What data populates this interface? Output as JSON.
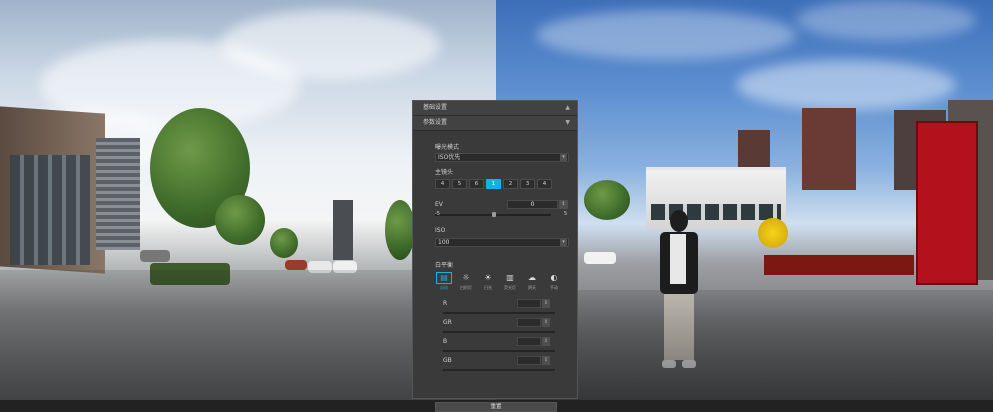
{
  "panel": {
    "section_basic": "基础设置",
    "section_params": "参数设置",
    "exposure_mode_label": "曝光模式",
    "exposure_mode_value": "ISO优先",
    "main_lens_label": "主镜头",
    "lens_options": [
      "4",
      "5",
      "6",
      "1",
      "2",
      "3",
      "4"
    ],
    "lens_selected": "1",
    "ev_label": "EV",
    "ev_value": "0",
    "ev_min": "-5",
    "ev_max": "5",
    "iso_label": "ISO",
    "iso_value": "100",
    "wb_label": "白平衡",
    "wb_modes": [
      "自动",
      "白炽灯",
      "日光",
      "荧光灯",
      "阴天",
      "手动"
    ],
    "wb_selected": "自动",
    "channels": [
      "R",
      "GR",
      "B",
      "GB"
    ],
    "reset_label": "重置"
  },
  "colors": {
    "accent": "#13b2e6",
    "panel_bg": "#3a3a3a"
  }
}
